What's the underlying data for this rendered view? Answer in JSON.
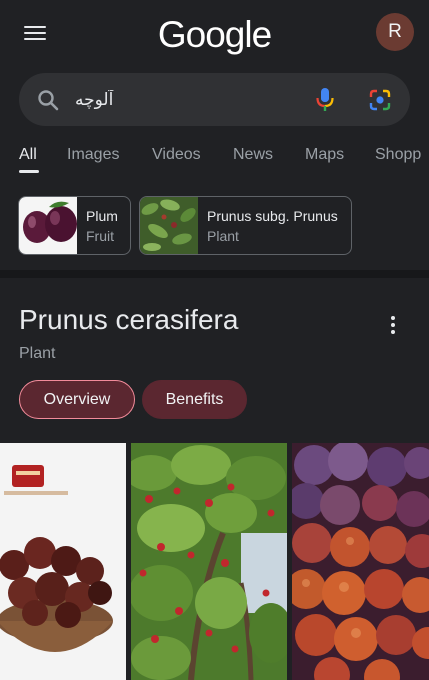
{
  "header": {
    "logo_text": "Google",
    "avatar_initial": "R"
  },
  "search": {
    "query": "آلوچه"
  },
  "tabs": [
    {
      "label": "All",
      "active": true
    },
    {
      "label": "Images",
      "active": false
    },
    {
      "label": "Videos",
      "active": false
    },
    {
      "label": "News",
      "active": false
    },
    {
      "label": "Maps",
      "active": false
    },
    {
      "label": "Shopp",
      "active": false
    }
  ],
  "chips": [
    {
      "title": "Plum",
      "subtitle": "Fruit"
    },
    {
      "title": "Prunus subg. Prunus",
      "subtitle": "Plant"
    }
  ],
  "knowledge_panel": {
    "title": "Prunus cerasifera",
    "subtitle": "Plant",
    "buttons": [
      {
        "label": "Overview",
        "active": true
      },
      {
        "label": "Benefits",
        "active": false
      }
    ]
  },
  "images": [
    {
      "alt": "dried plums in bowl"
    },
    {
      "alt": "cherry plum tree"
    },
    {
      "alt": "dried red plums"
    }
  ],
  "colors": {
    "background": "#202124",
    "search_bg": "#303134",
    "pill_bg": "#5b2730",
    "pill_border": "#f28b9a",
    "avatar_bg": "#6b3b32"
  }
}
